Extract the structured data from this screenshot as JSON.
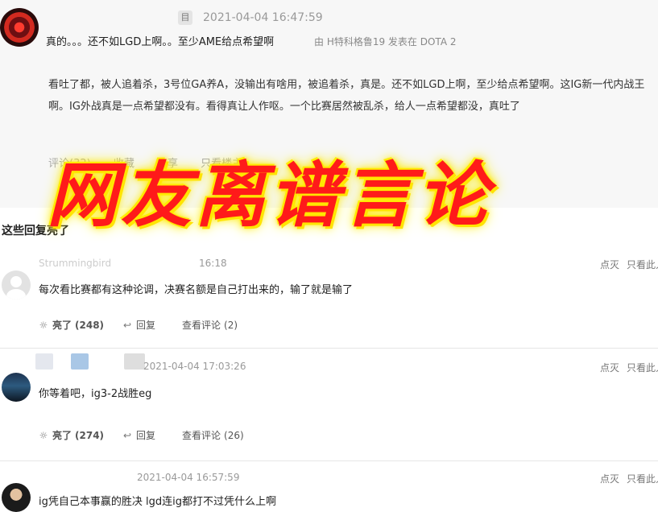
{
  "post": {
    "badge": "目",
    "timestamp": "2021-04-04 16:47:59",
    "subject": "真的。。。还不如LGD上啊。。至少AME给点希望啊",
    "meta": "由 H特科格鲁19 发表在  DOTA 2",
    "body": "看吐了都，被人追着杀，3号位GA养A，没输出有啥用，被追着杀，真是。还不如LGD上啊，至少给点希望啊。这IG新一代内战王啊。IG外战真是一点希望都没有。看得真让人作呕。一个比赛居然被乱杀，给人一点希望都没，真吐了",
    "faded_actions": [
      "评论(32)",
      "收藏",
      "分享",
      "只看楼主"
    ]
  },
  "overlay": {
    "title": "网友离谱言论"
  },
  "section": {
    "title": "这些回复亮了"
  },
  "comments": [
    {
      "name": "Strummingbird",
      "time": "16:18",
      "text": "每次看比赛都有这种论调，决赛名额是自己打出来的，输了就是输了",
      "like_label": "亮了",
      "likes": "(248)",
      "reply_label": "回复",
      "view_label": "查看评论",
      "views": "(2)",
      "report_label": "点灭",
      "only_label": "只看此人"
    },
    {
      "time": "2021-04-04 17:03:26",
      "text": "你等着吧，ig3-2战胜eg",
      "like_label": "亮了",
      "likes": "(274)",
      "reply_label": "回复",
      "view_label": "查看评论",
      "views": "(26)",
      "report_label": "点灭",
      "only_label": "只看此人"
    },
    {
      "time": "2021-04-04 16:57:59",
      "text": "ig凭自己本事赢的胜决 lgd连ig都打不过凭什么上啊",
      "report_label": "点灭",
      "only_label": "只看此人"
    }
  ],
  "colors": {
    "overlay_red": "#ff1a1a",
    "overlay_glow": "#ffe600"
  },
  "icons": {
    "like": "lightbulb-icon",
    "reply": "reply-arrow-icon"
  }
}
